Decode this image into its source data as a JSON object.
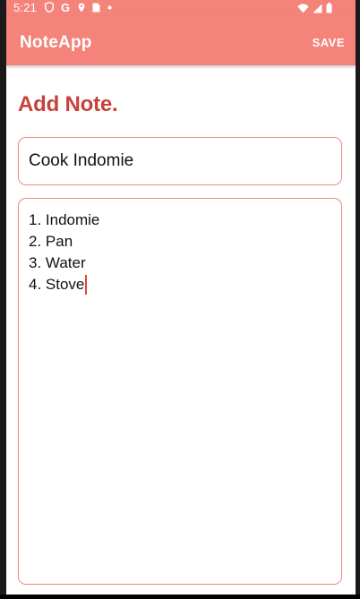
{
  "status_bar": {
    "time": "5:21",
    "left_icons": [
      "shield-icon",
      "google-icon",
      "location-icon",
      "sim-card-icon",
      "notification-dot-icon"
    ],
    "right_icons": [
      "wifi-icon",
      "signal-icon",
      "battery-icon"
    ]
  },
  "app_bar": {
    "title": "NoteApp",
    "save_label": "SAVE",
    "color": "#f4837a"
  },
  "form": {
    "heading": "Add Note.",
    "heading_color": "#c9403b",
    "title_value": "Cook Indomie",
    "body_lines": [
      "1. Indomie",
      "2. Pan",
      "3. Water",
      "4. Stove"
    ],
    "border_color": "#ee8a80"
  }
}
